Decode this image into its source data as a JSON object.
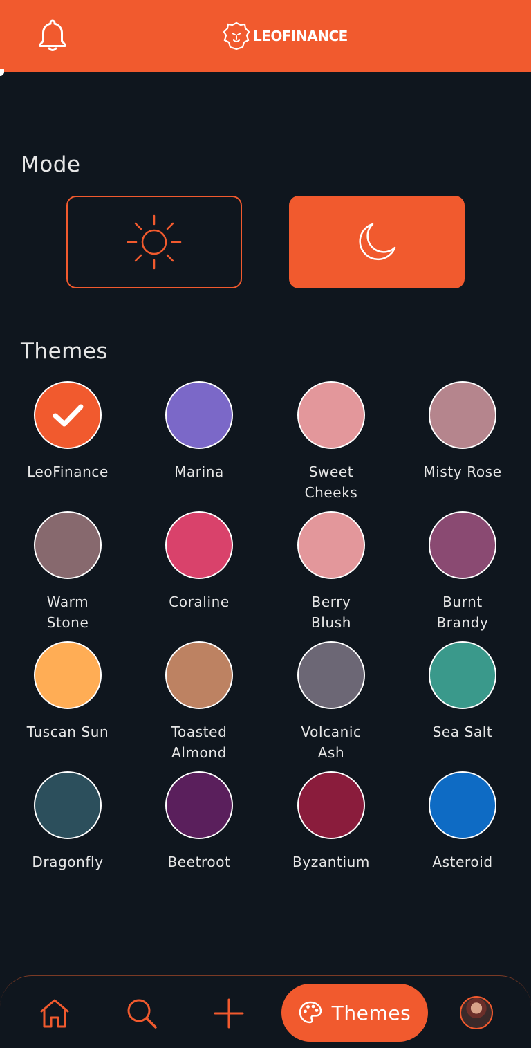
{
  "header": {
    "brand_text": "LEOFINANCE",
    "bg_color": "#f15a2e"
  },
  "mode": {
    "title": "Mode",
    "options": [
      {
        "icon": "sun-icon",
        "selected": false
      },
      {
        "icon": "moon-icon",
        "selected": true
      }
    ]
  },
  "themes": {
    "title": "Themes",
    "items": [
      {
        "label": "LeoFinance",
        "color": "#f15a2e",
        "selected": true
      },
      {
        "label": "Marina",
        "color": "#7b68c8",
        "selected": false
      },
      {
        "label": "Sweet Cheeks",
        "color": "#e3979b",
        "selected": false
      },
      {
        "label": "Misty Rose",
        "color": "#b5858d",
        "selected": false
      },
      {
        "label": "Warm Stone",
        "color": "#87696e",
        "selected": false
      },
      {
        "label": "Coraline",
        "color": "#d9426b",
        "selected": false
      },
      {
        "label": "Berry Blush",
        "color": "#e3979b",
        "selected": false
      },
      {
        "label": "Burnt Brandy",
        "color": "#8a4a72",
        "selected": false
      },
      {
        "label": "Tuscan Sun",
        "color": "#ffad55",
        "selected": false
      },
      {
        "label": "Toasted Almond",
        "color": "#bd8262",
        "selected": false
      },
      {
        "label": "Volcanic Ash",
        "color": "#6c6775",
        "selected": false
      },
      {
        "label": "Sea Salt",
        "color": "#3a998b",
        "selected": false
      },
      {
        "label": "Dragonfly",
        "color": "#2c4f5c",
        "selected": false
      },
      {
        "label": "Beetroot",
        "color": "#5a1f5c",
        "selected": false
      },
      {
        "label": "Byzantium",
        "color": "#8a1c3c",
        "selected": false
      },
      {
        "label": "Asteroid",
        "color": "#0e6bc4",
        "selected": false
      }
    ]
  },
  "bottom_nav": {
    "items": [
      "home-icon",
      "search-icon",
      "plus-icon"
    ],
    "active_label": "Themes",
    "accent": "#f15a2e"
  }
}
